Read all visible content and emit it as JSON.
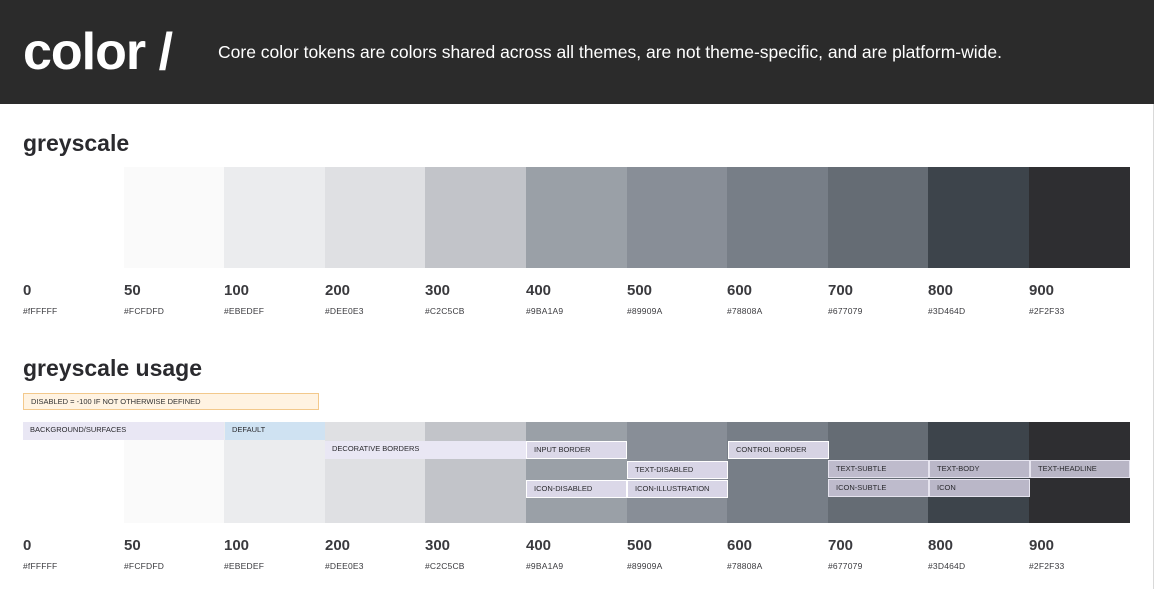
{
  "header": {
    "title": "color /",
    "description": "Core color tokens are colors shared across all themes, are not theme-specific, and are platform-wide."
  },
  "sections": {
    "greyscale_title": "greyscale",
    "usage_title": "greyscale usage"
  },
  "swatches": [
    {
      "num": "0",
      "hex": "#fFFFFF",
      "color": "#ffffff"
    },
    {
      "num": "50",
      "hex": "#FCFDFD",
      "color": "#fafafa"
    },
    {
      "num": "100",
      "hex": "#EBEDEF",
      "color": "#ebecee"
    },
    {
      "num": "200",
      "hex": "#DEE0E3",
      "color": "#dfe0e3"
    },
    {
      "num": "300",
      "hex": "#C2C5CB",
      "color": "#c2c4c9"
    },
    {
      "num": "400",
      "hex": "#9BA1A9",
      "color": "#9aa0a7"
    },
    {
      "num": "500",
      "hex": "#89909A",
      "color": "#888e97"
    },
    {
      "num": "600",
      "hex": "#78808A",
      "color": "#777e87"
    },
    {
      "num": "700",
      "hex": "#677079",
      "color": "#656c74"
    },
    {
      "num": "800",
      "hex": "#3D464D",
      "color": "#3d444b"
    },
    {
      "num": "900",
      "hex": "#2F2F33",
      "color": "#2e2e31"
    }
  ],
  "usage": {
    "note": "DISABLED = -100 IF NOT OTHERWISE DEFINED",
    "tags": {
      "background": "BACKGROUND/SURFACES",
      "default": "DEFAULT",
      "decorative": "DECORATIVE BORDERS",
      "input_border": "INPUT BORDER",
      "icon_disabled": "ICON-DISABLED",
      "text_disabled": "TEXT-DISABLED",
      "icon_illustration": "ICON-ILLUSTRATION",
      "control_border": "CONTROL BORDER",
      "text_subtle": "TEXT-SUBTLE",
      "icon_subtle": "ICON-SUBTLE",
      "text_body": "TEXT-BODY",
      "icon": "ICON",
      "text_headline": "TEXT-HEADLINE"
    }
  }
}
